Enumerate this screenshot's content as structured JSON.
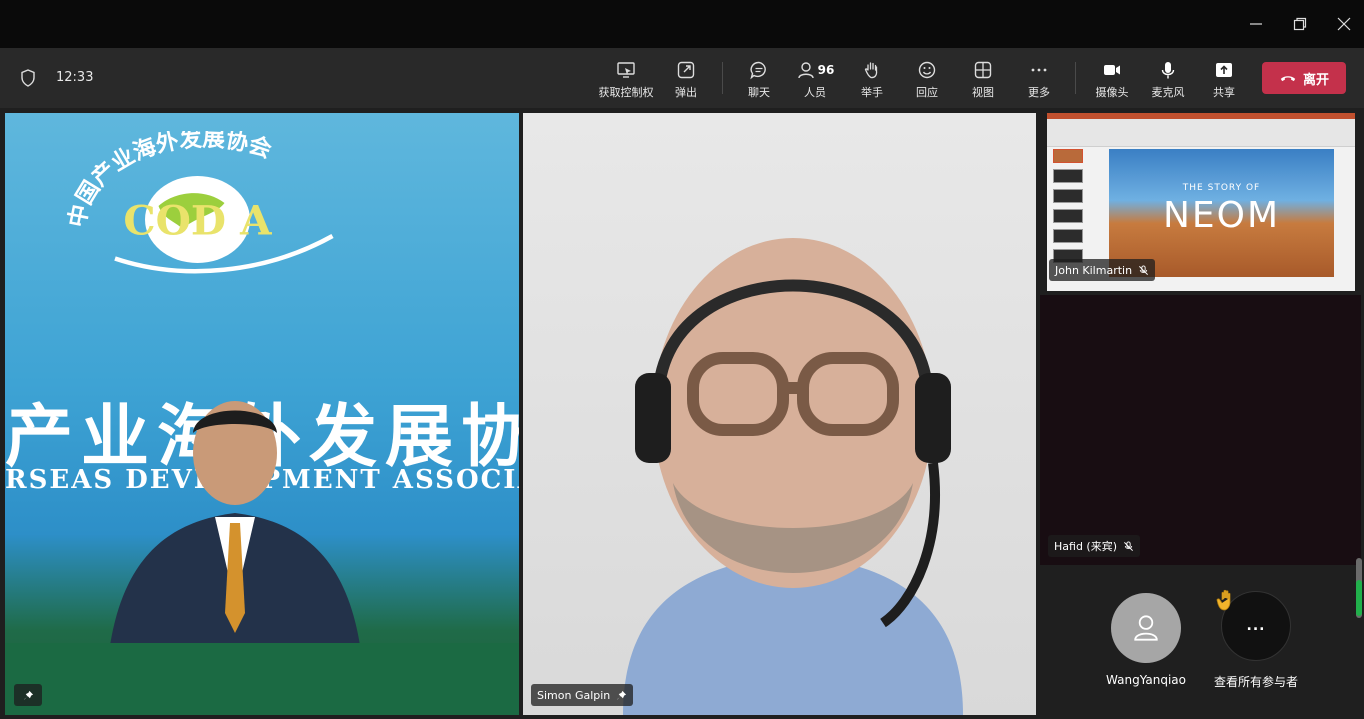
{
  "titlebar": {},
  "toolbar": {
    "time": "12:33",
    "items": [
      {
        "name": "take-control",
        "label": "获取控制权"
      },
      {
        "name": "pop-out",
        "label": "弹出"
      },
      {
        "name": "chat",
        "label": "聊天"
      },
      {
        "name": "people",
        "label": "人员",
        "count": "96"
      },
      {
        "name": "raise-hand",
        "label": "举手"
      },
      {
        "name": "reactions",
        "label": "回应"
      },
      {
        "name": "view",
        "label": "视图"
      },
      {
        "name": "more",
        "label": "更多"
      },
      {
        "name": "camera",
        "label": "摄像头"
      },
      {
        "name": "mic",
        "label": "麦克风"
      },
      {
        "name": "share",
        "label": "共享"
      }
    ],
    "leave_label": "离开"
  },
  "tiles": {
    "left": {
      "arc_text": "中国产业海外发展协会",
      "logo_text": "COD A",
      "banner_cn": "产业海外发展协",
      "banner_en": "RSEAS DEVELOPMENT ASSOCIAT"
    },
    "middle": {
      "name": "Simon Galpin"
    },
    "top_right": {
      "name": "John Kilmartin",
      "slide_subtitle": "THE STORY OF",
      "slide_title": "NEOM"
    },
    "mid_right": {
      "name": "Hafid (来宾)"
    }
  },
  "participants": [
    {
      "name": "WangYanqiao"
    },
    {
      "name": "查看所有参与者",
      "symbol": "..."
    }
  ],
  "colors": {
    "leave": "#c4314b",
    "toolbar": "#292929",
    "scroll_accent": "#21b04b"
  }
}
